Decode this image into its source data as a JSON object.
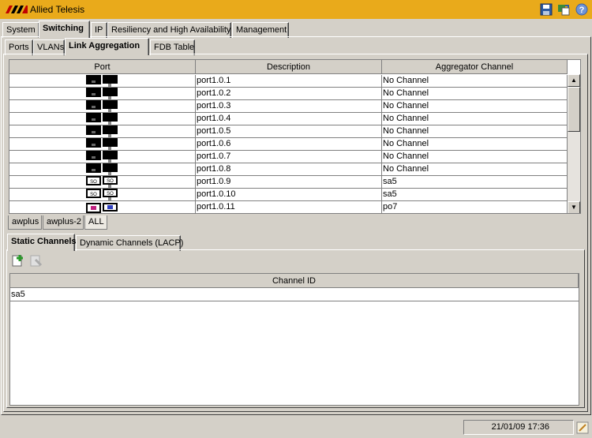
{
  "app": {
    "title": "Allied Telesis"
  },
  "titlebar_icons": [
    "save-icon",
    "swap-icon",
    "help-icon"
  ],
  "main_tabs": [
    "System",
    "Switching",
    "IP",
    "Resiliency and High Availability",
    "Management"
  ],
  "sub_tabs": [
    "Ports",
    "VLANs",
    "Link Aggregation",
    "FDB Table"
  ],
  "port_table": {
    "headers": [
      "Port",
      "Description",
      "Aggregator Channel"
    ],
    "rows": [
      {
        "description": "port1.0.1",
        "channel": "No Channel"
      },
      {
        "description": "port1.0.2",
        "channel": "No Channel"
      },
      {
        "description": "port1.0.3",
        "channel": "No Channel"
      },
      {
        "description": "port1.0.4",
        "channel": "No Channel"
      },
      {
        "description": "port1.0.5",
        "channel": "No Channel"
      },
      {
        "description": "port1.0.6",
        "channel": "No Channel"
      },
      {
        "description": "port1.0.7",
        "channel": "No Channel"
      },
      {
        "description": "port1.0.8",
        "channel": "No Channel"
      },
      {
        "description": "port1.0.9",
        "channel": "sa5",
        "tag": "SO"
      },
      {
        "description": "port1.0.10",
        "channel": "sa5",
        "tag": "SO"
      },
      {
        "description": "port1.0.11",
        "channel": "po7"
      }
    ]
  },
  "device_tabs": [
    "awplus",
    "awplus-2",
    "ALL"
  ],
  "channel_tabs": [
    "Static Channels",
    "Dynamic Channels (LACP)"
  ],
  "channel_table": {
    "header": "Channel ID",
    "rows": [
      "sa5"
    ]
  },
  "toolbar_icons": [
    "add-channel-icon",
    "remove-channel-icon"
  ],
  "status": {
    "datetime": "21/01/09 17:36"
  },
  "colors": {
    "titlebar": "#e9aa1b",
    "window_bg": "#d4d0c8"
  }
}
